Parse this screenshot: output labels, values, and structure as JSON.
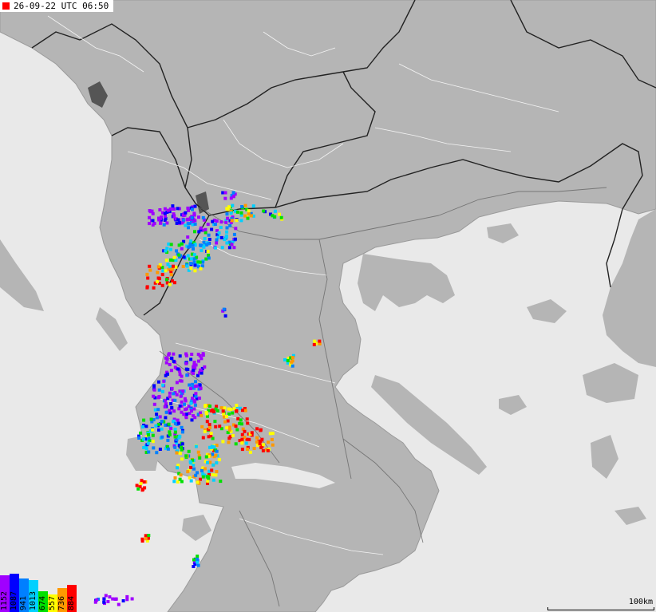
{
  "map": {
    "timestamp": "26-09-22 UTC 06:50",
    "scale_label": "100km",
    "colors": {
      "sea": "#e9e9e9",
      "land": "#b5b5b5",
      "borders": "#222222",
      "rivers": "#ffffff"
    },
    "legend": [
      {
        "label": "1152",
        "color": "#a000ff"
      },
      {
        "label": "1087",
        "color": "#0000ff"
      },
      {
        "label": "941",
        "color": "#0080ff"
      },
      {
        "label": "1013",
        "color": "#00d0ff"
      },
      {
        "label": "674",
        "color": "#00e000"
      },
      {
        "label": "557",
        "color": "#ffff00"
      },
      {
        "label": "736",
        "color": "#ff9900"
      },
      {
        "label": "884",
        "color": "#ff0000"
      }
    ]
  }
}
